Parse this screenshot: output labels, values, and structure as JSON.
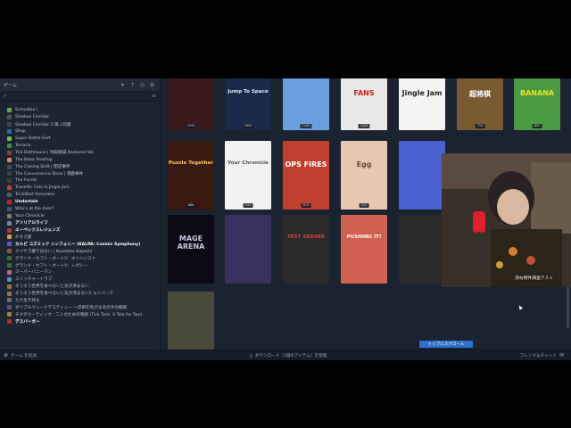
{
  "sidebar": {
    "header_label": "ゲーム",
    "header_controls": [
      "chevron-down-icon",
      "sort-icon",
      "clock-icon",
      "filter-icon"
    ],
    "search_placeholder": "",
    "games": [
      {
        "label": "Schoolbie !",
        "color": "#6aa84f",
        "highlight": false
      },
      {
        "label": "Shadow Corridor",
        "color": "#555555",
        "highlight": false
      },
      {
        "label": "Shadow Corridor 2 雨ノ四葉",
        "color": "#444444",
        "highlight": false
      },
      {
        "label": "Shop",
        "color": "#2b6cb0",
        "highlight": false
      },
      {
        "label": "Super Battle Golf",
        "color": "#7dbb3b",
        "highlight": false
      },
      {
        "label": "Terraria",
        "color": "#3e8e41",
        "highlight": false
      },
      {
        "label": "The Bathhouse | 地獄銭湯 Restored Ver.",
        "color": "#8a3a3a",
        "highlight": false
      },
      {
        "label": "The Boba Teashop",
        "color": "#d08a6a",
        "highlight": false
      },
      {
        "label": "The Closing Shift | 閉店事件",
        "color": "#444a55",
        "highlight": false
      },
      {
        "label": "The Convenience Store | 夜勤事件",
        "color": "#3a4050",
        "highlight": false
      },
      {
        "label": "The Forest",
        "color": "#2f4a2f",
        "highlight": false
      },
      {
        "label": "Travellin Cats in Jingle Jam",
        "color": "#c04040",
        "highlight": false
      },
      {
        "label": "TrickShot Simulator",
        "color": "#506070",
        "highlight": false
      },
      {
        "label": "Undertale",
        "color": "#cc2222",
        "highlight": true
      },
      {
        "label": "Who's at the door?",
        "color": "#445566",
        "highlight": false
      },
      {
        "label": "Your Chronicle",
        "color": "#8a7a5a",
        "highlight": false
      },
      {
        "label": "アソリアルライフ",
        "color": "#6a8aa0",
        "highlight": true
      },
      {
        "label": "エーペックスレジェンズ",
        "color": "#c03030",
        "highlight": true
      },
      {
        "label": "かぞえ部",
        "color": "#d0a040",
        "highlight": false
      },
      {
        "label": "カルピ コズミック シンフォニー (KALPA: Cosmic Symphony)",
        "color": "#5a5ad0",
        "highlight": true
      },
      {
        "label": "クソゲズ嫌ではない | Kusoteka Bayashi",
        "color": "#8a5a3a",
        "highlight": false
      },
      {
        "label": "グランド・セフト・オートV：エンハンスト",
        "color": "#3a6a3a",
        "highlight": false
      },
      {
        "label": "グランド・セフト・オートV：レガシー",
        "color": "#3a6a3a",
        "highlight": false
      },
      {
        "label": "スーパーバニーマン",
        "color": "#d06090",
        "highlight": false
      },
      {
        "label": "スイッチャートラブ",
        "color": "#5090c0",
        "highlight": false
      },
      {
        "label": "そうそう世界を食べないと気が済まない",
        "color": "#a07040",
        "highlight": false
      },
      {
        "label": "そうそう世界を食べないと気が済まない2 エニバース",
        "color": "#a07040",
        "highlight": false
      },
      {
        "label": "ただ生き残る",
        "color": "#707070",
        "highlight": false
      },
      {
        "label": "ダンプルウィードデスティニー ～忍術を私がまあの手の痕跡",
        "color": "#6a4a8a",
        "highlight": false
      },
      {
        "label": "チクタク・ティック：二人のための物語 (Tick Tock: A Tale for Two)",
        "color": "#a08040",
        "highlight": false
      },
      {
        "label": "デスバーガー",
        "color": "#b03030",
        "highlight": true
      }
    ]
  },
  "covers": [
    {
      "title": "",
      "badge": "2933",
      "bg": "#3a1a1a",
      "fg": "#ffffff"
    },
    {
      "title": "Jump To Space",
      "badge": "2859",
      "bg": "#1a2a4a",
      "fg": "#e0e8ff"
    },
    {
      "title": "",
      "badge": "1343",
      "bg": "#6aa0e0",
      "fg": "#ffffff"
    },
    {
      "title": "FANS",
      "badge": "1858",
      "bg": "#e8e8e8",
      "fg": "#d02020"
    },
    {
      "title": "Jingle Jam",
      "badge": "",
      "bg": "#f4f4f4",
      "fg": "#222222"
    },
    {
      "title": "超将棋",
      "badge": "753",
      "bg": "#7a5a30",
      "fg": "#ffffff"
    },
    {
      "title": "BANANA",
      "badge": "892",
      "bg": "#4a9a40",
      "fg": "#f0e020"
    },
    {
      "title": "Puzzle Together",
      "badge": "888",
      "bg": "#3a1a10",
      "fg": "#ffd050"
    },
    {
      "title": "Your Chronicle",
      "badge": "541",
      "bg": "#f2f2f2",
      "fg": "#555555"
    },
    {
      "title": "OPS FIRES",
      "badge": "873",
      "bg": "#c04030",
      "fg": "#ffffff"
    },
    {
      "title": "Egg",
      "badge": "331",
      "bg": "#e8c8b0",
      "fg": "#6a4a3a"
    },
    {
      "title": "",
      "badge": "",
      "bg": "#4a60d0",
      "fg": "#ffffff"
    },
    {
      "title": "MAGE ARENA",
      "badge": "",
      "bg": "#0a0a14",
      "fg": "#c8c8e0"
    },
    {
      "title": "",
      "badge": "",
      "bg": "#3a3060",
      "fg": "#ffffff"
    },
    {
      "title": "TEST SERVER",
      "badge": "",
      "bg": "#2a2a2a",
      "fg": "#e04040"
    },
    {
      "title": "PUSHING IT!",
      "badge": "",
      "bg": "#d06050",
      "fg": "#ffffff"
    },
    {
      "title": "",
      "badge": "",
      "bg": "#2a2a2a",
      "fg": "#ffffff"
    },
    {
      "title": "",
      "badge": "",
      "bg": "#4a4a3a",
      "fg": "#ffffff"
    }
  ],
  "scroll_top_label": "トップにスクロール",
  "bottombar": {
    "left_label": "ゲーム を追加",
    "mid_label": "ダウンロード（1個のアイテム）を管理",
    "right_label": "フレンド＆チャット"
  },
  "webcam_caption": "涼ね物件調査テスト"
}
